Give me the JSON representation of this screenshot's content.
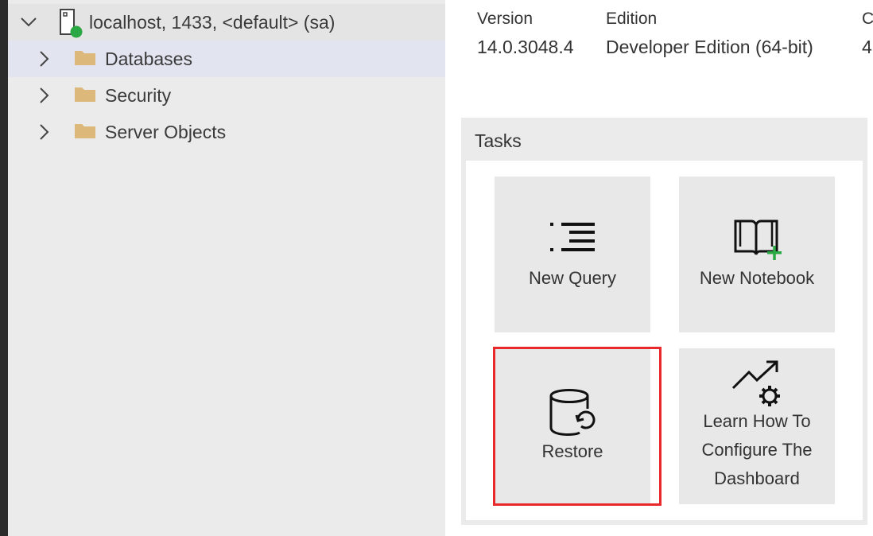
{
  "tree": {
    "server": {
      "label": "localhost, 1433, <default> (sa)",
      "icon": "server-icon",
      "status_color": "#2aa844"
    },
    "nodes": [
      {
        "label": "Databases",
        "icon": "folder-icon",
        "selected": true
      },
      {
        "label": "Security",
        "icon": "folder-icon"
      },
      {
        "label": "Server Objects",
        "icon": "folder-icon"
      }
    ]
  },
  "properties": [
    {
      "label": "Version",
      "value": "14.0.3048.4"
    },
    {
      "label": "Edition",
      "value": "Developer Edition (64-bit)"
    },
    {
      "label": "C",
      "value": "4"
    }
  ],
  "tasks": {
    "title": "Tasks",
    "tiles": [
      {
        "label": "New Query",
        "icon": "new-query-icon"
      },
      {
        "label": "New Notebook",
        "icon": "new-notebook-icon"
      },
      {
        "label": "Restore",
        "icon": "restore-icon"
      },
      {
        "label_lines": [
          "Learn How To",
          "Configure The",
          "Dashboard"
        ],
        "icon": "configure-dashboard-icon"
      }
    ]
  },
  "colors": {
    "highlight": "#e8282a",
    "folder": "#dcb97a",
    "add_green": "#2aa844"
  }
}
